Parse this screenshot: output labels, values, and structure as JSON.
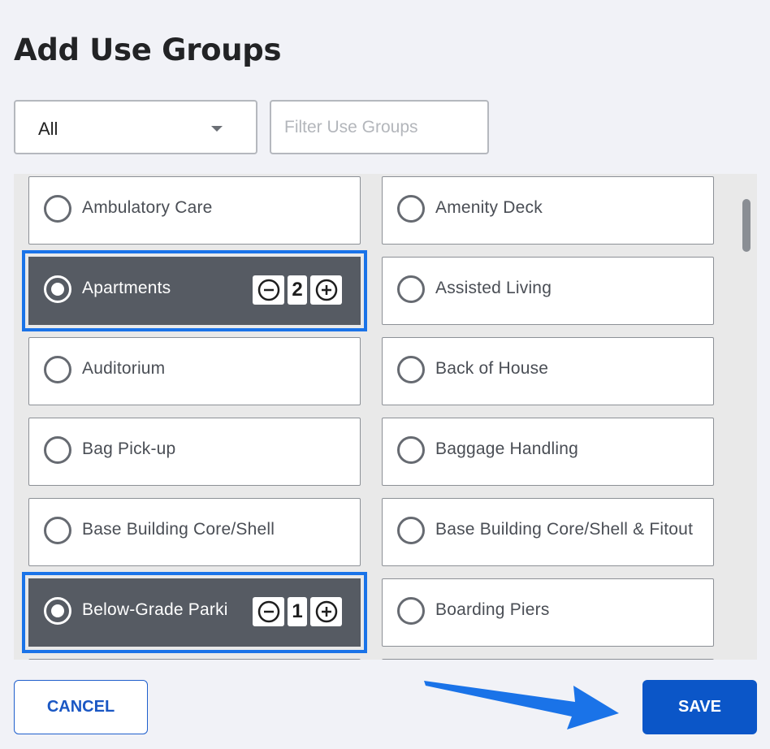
{
  "dialog": {
    "title": "Add Use Groups"
  },
  "filter_bar": {
    "category_select_value": "All",
    "search_placeholder": "Filter Use Groups"
  },
  "use_groups": [
    {
      "label": "Ambulatory Care",
      "selected": false
    },
    {
      "label": "Amenity Deck",
      "selected": false
    },
    {
      "label": "Apartments",
      "selected": true,
      "count": "2"
    },
    {
      "label": "Assisted Living",
      "selected": false
    },
    {
      "label": "Auditorium",
      "selected": false
    },
    {
      "label": "Back of House",
      "selected": false
    },
    {
      "label": "Bag Pick-up",
      "selected": false
    },
    {
      "label": "Baggage Handling",
      "selected": false
    },
    {
      "label": "Base Building Core/Shell",
      "selected": false
    },
    {
      "label": "Base Building Core/Shell & Fitout",
      "selected": false
    },
    {
      "label": "Below-Grade Parki",
      "selected": true,
      "count": "1"
    },
    {
      "label": "Boarding Piers",
      "selected": false
    }
  ],
  "actions": {
    "cancel_label": "CANCEL",
    "save_label": "SAVE"
  },
  "colors": {
    "accent": "#0b56c8",
    "selection_outline": "#1a73e8",
    "selected_card": "#565b63",
    "background": "#f1f2f7"
  },
  "icons": {
    "dropdown": "chevron-down-icon",
    "decrement": "minus-circle-icon",
    "increment": "plus-circle-icon",
    "annotation": "arrow-right-icon"
  }
}
